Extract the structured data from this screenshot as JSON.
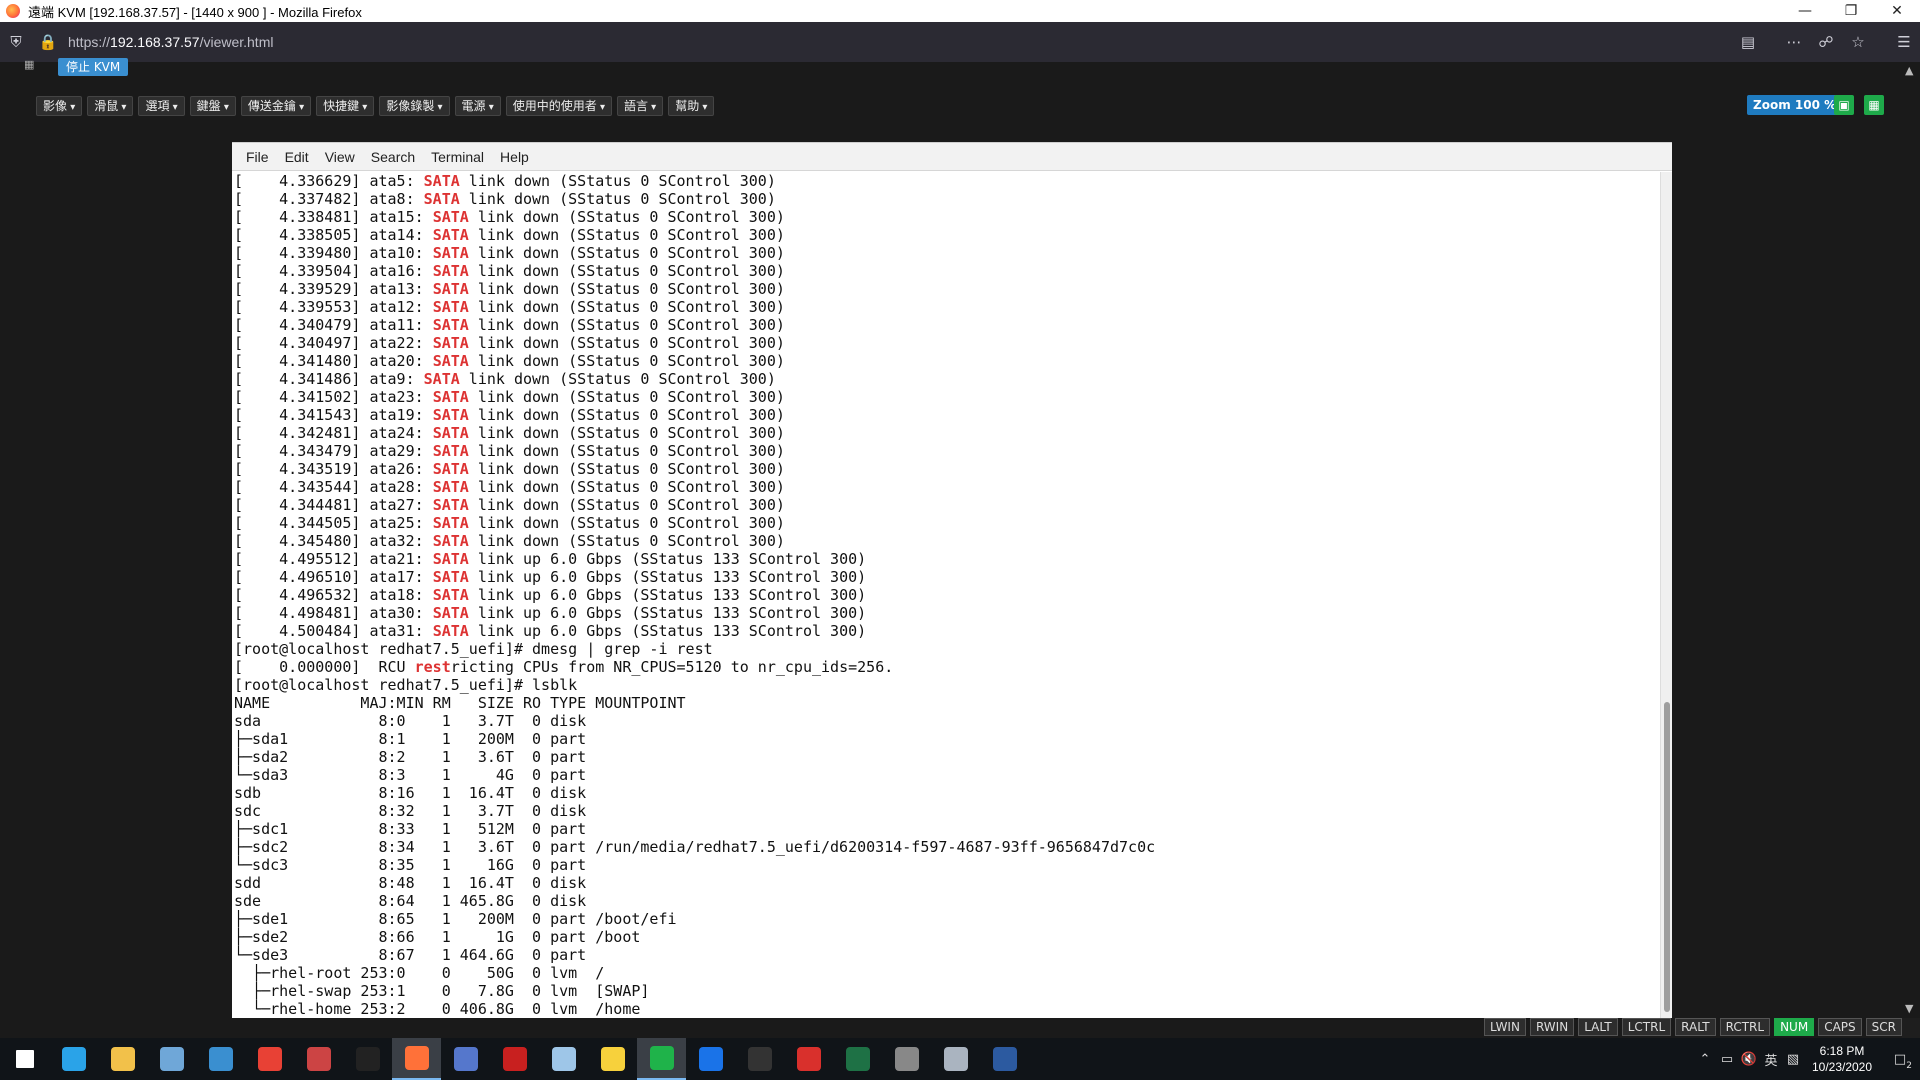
{
  "window": {
    "title": "遠端 KVM [192.168.37.57] - [1440 x 900 ] - Mozilla Firefox",
    "minimize_icon": "minimize-icon",
    "maximize_icon": "restore-icon",
    "close_icon": "close-icon"
  },
  "urlbar": {
    "url_prefix": "https://",
    "url_host": "192.168.37.57",
    "url_path": "/viewer.html"
  },
  "kvm": {
    "stop_label": "停止 KVM",
    "menus": [
      "影像",
      "滑鼠",
      "選項",
      "鍵盤",
      "傳送金鑰",
      "快捷鍵",
      "影像錄製",
      "電源",
      "使用中的使用者",
      "語言",
      "幫助"
    ],
    "zoom_label": "Zoom 100 %"
  },
  "terminal": {
    "menu": [
      "File",
      "Edit",
      "View",
      "Search",
      "Terminal",
      "Help"
    ],
    "lines": [
      [
        "[    4.336629] ata5: ",
        "SATA",
        " link down (SStatus 0 SControl 300)"
      ],
      [
        "[    4.337482] ata8: ",
        "SATA",
        " link down (SStatus 0 SControl 300)"
      ],
      [
        "[    4.338481] ata15: ",
        "SATA",
        " link down (SStatus 0 SControl 300)"
      ],
      [
        "[    4.338505] ata14: ",
        "SATA",
        " link down (SStatus 0 SControl 300)"
      ],
      [
        "[    4.339480] ata10: ",
        "SATA",
        " link down (SStatus 0 SControl 300)"
      ],
      [
        "[    4.339504] ata16: ",
        "SATA",
        " link down (SStatus 0 SControl 300)"
      ],
      [
        "[    4.339529] ata13: ",
        "SATA",
        " link down (SStatus 0 SControl 300)"
      ],
      [
        "[    4.339553] ata12: ",
        "SATA",
        " link down (SStatus 0 SControl 300)"
      ],
      [
        "[    4.340479] ata11: ",
        "SATA",
        " link down (SStatus 0 SControl 300)"
      ],
      [
        "[    4.340497] ata22: ",
        "SATA",
        " link down (SStatus 0 SControl 300)"
      ],
      [
        "[    4.341480] ata20: ",
        "SATA",
        " link down (SStatus 0 SControl 300)"
      ],
      [
        "[    4.341486] ata9: ",
        "SATA",
        " link down (SStatus 0 SControl 300)"
      ],
      [
        "[    4.341502] ata23: ",
        "SATA",
        " link down (SStatus 0 SControl 300)"
      ],
      [
        "[    4.341543] ata19: ",
        "SATA",
        " link down (SStatus 0 SControl 300)"
      ],
      [
        "[    4.342481] ata24: ",
        "SATA",
        " link down (SStatus 0 SControl 300)"
      ],
      [
        "[    4.343479] ata29: ",
        "SATA",
        " link down (SStatus 0 SControl 300)"
      ],
      [
        "[    4.343519] ata26: ",
        "SATA",
        " link down (SStatus 0 SControl 300)"
      ],
      [
        "[    4.343544] ata28: ",
        "SATA",
        " link down (SStatus 0 SControl 300)"
      ],
      [
        "[    4.344481] ata27: ",
        "SATA",
        " link down (SStatus 0 SControl 300)"
      ],
      [
        "[    4.344505] ata25: ",
        "SATA",
        " link down (SStatus 0 SControl 300)"
      ],
      [
        "[    4.345480] ata32: ",
        "SATA",
        " link down (SStatus 0 SControl 300)"
      ],
      [
        "[    4.495512] ata21: ",
        "SATA",
        " link up 6.0 Gbps (SStatus 133 SControl 300)"
      ],
      [
        "[    4.496510] ata17: ",
        "SATA",
        " link up 6.0 Gbps (SStatus 133 SControl 300)"
      ],
      [
        "[    4.496532] ata18: ",
        "SATA",
        " link up 6.0 Gbps (SStatus 133 SControl 300)"
      ],
      [
        "[    4.498481] ata30: ",
        "SATA",
        " link up 6.0 Gbps (SStatus 133 SControl 300)"
      ],
      [
        "[    4.500484] ata31: ",
        "SATA",
        " link up 6.0 Gbps (SStatus 133 SControl 300)"
      ],
      [
        "[root@localhost redhat7.5_uefi]# dmesg | grep -i rest",
        "",
        ""
      ],
      [
        "[    0.000000]  RCU ",
        "rest",
        "ricting CPUs from NR_CPUS=5120 to nr_cpu_ids=256."
      ],
      [
        "[root@localhost redhat7.5_uefi]# lsblk",
        "",
        ""
      ],
      [
        "NAME          MAJ:MIN RM   SIZE RO TYPE MOUNTPOINT",
        "",
        ""
      ],
      [
        "sda             8:0    1   3.7T  0 disk",
        "",
        ""
      ],
      [
        "├─sda1          8:1    1   200M  0 part",
        "",
        ""
      ],
      [
        "├─sda2          8:2    1   3.6T  0 part",
        "",
        ""
      ],
      [
        "└─sda3          8:3    1     4G  0 part",
        "",
        ""
      ],
      [
        "sdb             8:16   1  16.4T  0 disk",
        "",
        ""
      ],
      [
        "sdc             8:32   1   3.7T  0 disk",
        "",
        ""
      ],
      [
        "├─sdc1          8:33   1   512M  0 part",
        "",
        ""
      ],
      [
        "├─sdc2          8:34   1   3.6T  0 part /run/media/redhat7.5_uefi/d6200314-f597-4687-93ff-9656847d7c0c",
        "",
        ""
      ],
      [
        "└─sdc3          8:35   1    16G  0 part",
        "",
        ""
      ],
      [
        "sdd             8:48   1  16.4T  0 disk",
        "",
        ""
      ],
      [
        "sde             8:64   1 465.8G  0 disk",
        "",
        ""
      ],
      [
        "├─sde1          8:65   1   200M  0 part /boot/efi",
        "",
        ""
      ],
      [
        "├─sde2          8:66   1     1G  0 part /boot",
        "",
        ""
      ],
      [
        "└─sde3          8:67   1 464.6G  0 part",
        "",
        ""
      ],
      [
        "  ├─rhel-root 253:0    0    50G  0 lvm  /",
        "",
        ""
      ],
      [
        "  ├─rhel-swap 253:1    0   7.8G  0 lvm  [SWAP]",
        "",
        ""
      ],
      [
        "  └─rhel-home 253:2    0 406.8G  0 lvm  /home",
        "",
        ""
      ]
    ]
  },
  "keybar": {
    "keys": [
      {
        "label": "LWIN",
        "on": false
      },
      {
        "label": "RWIN",
        "on": false
      },
      {
        "label": "LALT",
        "on": false
      },
      {
        "label": "LCTRL",
        "on": false
      },
      {
        "label": "RALT",
        "on": false
      },
      {
        "label": "RCTRL",
        "on": false
      },
      {
        "label": "NUM",
        "on": true
      },
      {
        "label": "CAPS",
        "on": false
      },
      {
        "label": "SCR",
        "on": false
      }
    ]
  },
  "taskbar": {
    "apps": [
      {
        "name": "windows-start-icon",
        "color": "#ffffff",
        "active": false
      },
      {
        "name": "edge-icon",
        "color": "#2aa3e8",
        "active": false
      },
      {
        "name": "file-explorer-icon",
        "color": "#f2c14a",
        "active": false
      },
      {
        "name": "snipping-tool-icon",
        "color": "#6fa7d8",
        "active": false
      },
      {
        "name": "remote-desktop-icon",
        "color": "#3a8fd0",
        "active": false
      },
      {
        "name": "chrome-icon",
        "color": "#e84135",
        "active": false
      },
      {
        "name": "paint-icon",
        "color": "#c44",
        "active": false
      },
      {
        "name": "terminal-icon",
        "color": "#222222",
        "active": false
      },
      {
        "name": "firefox-icon",
        "color": "#ff7139",
        "active": true
      },
      {
        "name": "network-tool-icon",
        "color": "#5577cc",
        "active": false
      },
      {
        "name": "filezilla-icon",
        "color": "#c8201f",
        "active": false
      },
      {
        "name": "notes-icon",
        "color": "#9ec6e8",
        "active": false
      },
      {
        "name": "sticky-notes-icon",
        "color": "#f7d13c",
        "active": false
      },
      {
        "name": "line-icon",
        "color": "#1fb34a",
        "active": true
      },
      {
        "name": "teamviewer-icon",
        "color": "#1a73e8",
        "active": false
      },
      {
        "name": "camera-icon",
        "color": "#333333",
        "active": false
      },
      {
        "name": "pdf-icon",
        "color": "#d9302c",
        "active": false
      },
      {
        "name": "excel-icon",
        "color": "#1e7145",
        "active": false
      },
      {
        "name": "disc-tool-icon",
        "color": "#888888",
        "active": false
      },
      {
        "name": "system-tool-icon",
        "color": "#aab4c0",
        "active": false
      },
      {
        "name": "powershell-icon",
        "color": "#2c5aa0",
        "active": false
      }
    ],
    "tray_lang": "英",
    "time": "6:18 PM",
    "date": "10/23/2020",
    "notification_count": "2"
  }
}
